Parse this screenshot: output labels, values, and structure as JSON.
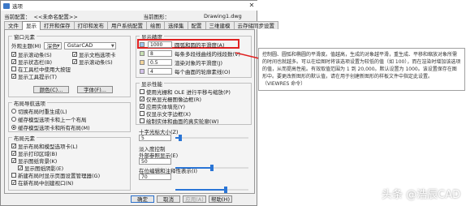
{
  "window": {
    "title": "选项",
    "close": "✕"
  },
  "profile": {
    "current_label": "当前配置：",
    "current_value": "<<未命名配置>>",
    "drawing_label": "当前图形：",
    "drawing_value": "Drawing1.dwg"
  },
  "tabs": [
    "文件",
    "显示",
    "打开和保存",
    "打印和发布",
    "用户系统配置",
    "绘图",
    "选择集",
    "配置",
    "三维建模",
    "云存储同步设置"
  ],
  "window_elements": {
    "title": "窗口元素",
    "theme_label": "外观主题(M)",
    "theme_value": "深色",
    "scheme_value": "GstarCAD",
    "options": [
      {
        "label": "显示滚动条(S)",
        "checked": true
      },
      {
        "label": "显示文档选项卡",
        "checked": true
      },
      {
        "label": "显示状态栏(B)",
        "checked": true
      },
      {
        "label": "显示滚动条(S)",
        "checked": true
      },
      {
        "label": "在工具栏中使用大按钮",
        "checked": false
      },
      {
        "label": "显示工具提示(T)",
        "checked": true
      }
    ],
    "colors_btn": "颜色(C)...",
    "fonts_btn": "字体(F)..."
  },
  "layout_tab": {
    "title": "布局导航选项",
    "options": [
      {
        "label": "切换布局时重生成(L)",
        "selected": false
      },
      {
        "label": "缓存模型选项卡和上一个布局",
        "selected": false
      },
      {
        "label": "缓存模型选项卡和所有布局(M)",
        "selected": true
      }
    ]
  },
  "layout_elements": {
    "title": "布局元素",
    "options": [
      {
        "label": "显示布局和模型选项卡(L)",
        "checked": true
      },
      {
        "label": "显示打印区域(B)",
        "checked": true
      },
      {
        "label": "显示图纸背景(K)",
        "checked": true
      },
      {
        "label": "显示图纸阴影(E)",
        "checked": true
      },
      {
        "label": "新建布局时显示页面设置管理器(G)",
        "checked": false
      },
      {
        "label": "在新布局中创建视口(N)",
        "checked": true
      }
    ]
  },
  "display_resolution": {
    "title": "显示精度",
    "items": [
      {
        "value": "1000",
        "label": "圆弧和圆的平滑度(A)"
      },
      {
        "value": "8",
        "label": "每条多段线曲线的线段数(V)"
      },
      {
        "value": "0.5",
        "label": "渲染对象的平滑度(J)"
      },
      {
        "value": "4",
        "label": "每个曲面的轮廓素线(O)"
      }
    ]
  },
  "display_performance": {
    "title": "显示性能",
    "options": [
      {
        "label": "使用光栅和 OLE 进行平移与缩放(P)",
        "checked": false
      },
      {
        "label": "仅亮显光栅图像边框(R)",
        "checked": true
      },
      {
        "label": "应用实体填充(Y)",
        "checked": true
      },
      {
        "label": "仅显示文字边框(X)",
        "checked": false
      },
      {
        "label": "绘制实体和曲面的真实轮廓(W)",
        "checked": false
      }
    ]
  },
  "crosshair": {
    "title": "十字光标大小(Z)",
    "value": "5",
    "fraction": 0.05
  },
  "fade": {
    "title": "淡入度控制",
    "xref_label": "外部参照显示(E)",
    "xref_value": "50",
    "xref_fraction": 0.5,
    "inplace_label": "在位编辑和注释性表示(I)",
    "inplace_value": "70",
    "inplace_fraction": 0.7
  },
  "buttons": {
    "ok": "确定",
    "cancel": "取消",
    "apply": "应用(A)",
    "help": "帮助(H)"
  },
  "tooltip": {
    "text": "控制圆、圆弧和椭圆的平滑度。值越高，生成的对象越平滑，重生成、平移和缩放对象所需的时间也就越多。可以在绘图时将该选项设置为较低的值（如 100），而在渲染时增加该选项的值，从而提高性能。有效取值范围为 1 到 20,000。默认设置为 1000。该设置保存在图形中。要更改新图形的默认值，请在用于创建新图形的样板文件中指定此设置。",
    "tail": "（VIEWRES 命令）"
  },
  "watermark": "头条 @浩辰CAD"
}
